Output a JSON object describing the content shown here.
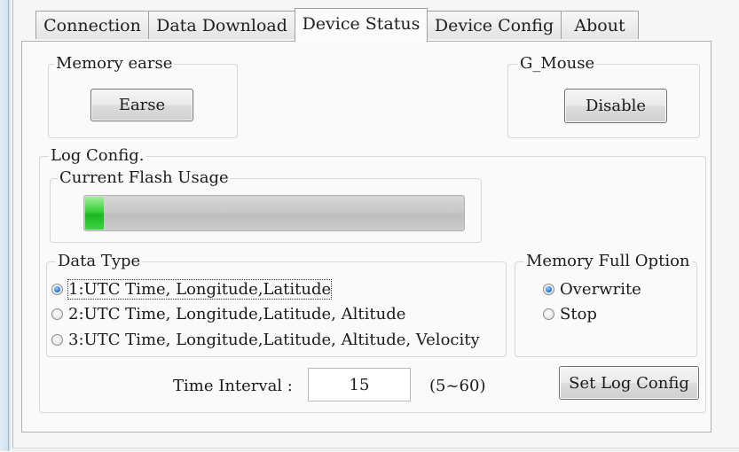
{
  "tabs": [
    {
      "label": "Connection"
    },
    {
      "label": "Data Download"
    },
    {
      "label": "Device Status"
    },
    {
      "label": "Device Config"
    },
    {
      "label": "About"
    }
  ],
  "active_tab": "Device Status",
  "memory_erase": {
    "group_label": "Memory earse",
    "button_label": "Earse"
  },
  "g_mouse": {
    "group_label": "G_Mouse",
    "button_label": "Disable"
  },
  "log_config": {
    "group_label": "Log Config.",
    "flash_usage": {
      "group_label": "Current Flash Usage",
      "progress_fraction": 0.05
    },
    "data_type": {
      "group_label": "Data Type",
      "options": [
        {
          "label": "1:UTC Time, Longitude,Latitude",
          "checked": true
        },
        {
          "label": "2:UTC Time, Longitude,Latitude, Altitude",
          "checked": false
        },
        {
          "label": "3:UTC Time, Longitude,Latitude, Altitude, Velocity",
          "checked": false
        }
      ]
    },
    "memory_full": {
      "group_label": "Memory Full Option",
      "options": [
        {
          "label": "Overwrite",
          "checked": true
        },
        {
          "label": "Stop",
          "checked": false
        }
      ]
    },
    "time_interval": {
      "label": "Time Interval :",
      "value": "15",
      "range_hint": "(5~60)"
    },
    "set_button_label": "Set Log Config"
  },
  "colors": {
    "progress_fill": "#22bb28",
    "radio_checked": "#2e7ed8"
  }
}
